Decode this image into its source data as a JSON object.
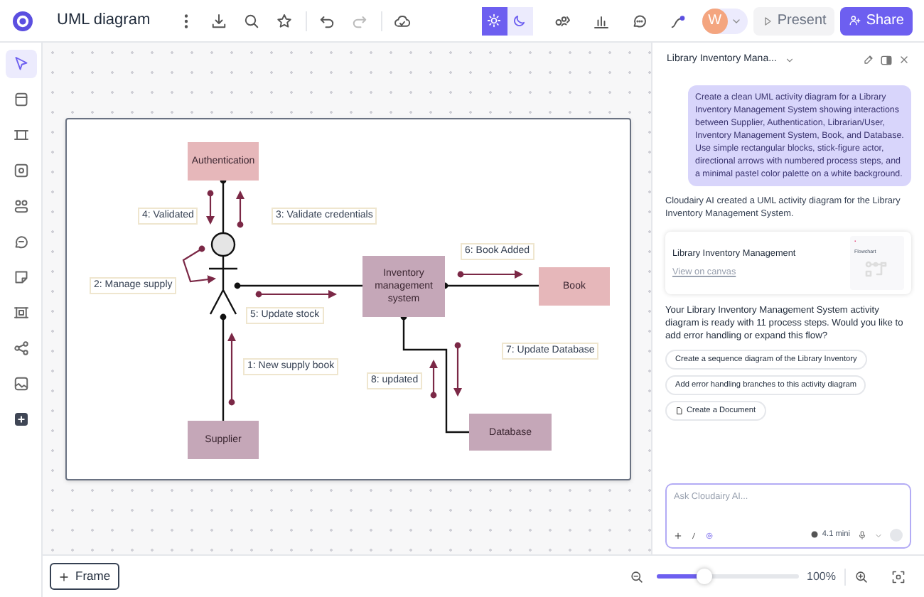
{
  "app": {
    "title": "UML diagram"
  },
  "theme_toggle": [
    {
      "selected": true
    },
    {
      "selected": false
    }
  ],
  "avatar": {
    "initial": "W"
  },
  "buttons": {
    "present": "Present",
    "share": "Share"
  },
  "tools": [
    {
      "selected": true
    },
    {
      "selected": false
    },
    {
      "selected": false
    },
    {
      "selected": false
    },
    {
      "selected": false
    },
    {
      "selected": false
    },
    {
      "selected": false
    },
    {
      "selected": false
    },
    {
      "selected": false
    },
    {
      "selected": false
    },
    {
      "selected": false
    }
  ],
  "diagram": {
    "nodes": [
      {
        "label": "Authentication",
        "color": "#e6b7ba"
      },
      {
        "label": "Inventory management system",
        "color": "#c5a7b8"
      },
      {
        "label": "Book",
        "color": "#e6b7ba"
      },
      {
        "label": "Supplier",
        "color": "#c5a7b8"
      },
      {
        "label": "Database",
        "color": "#c5a7b8"
      }
    ],
    "messages": [
      {
        "label": "4: Validated"
      },
      {
        "label": "3: Validate credentials"
      },
      {
        "label": "6: Book Added"
      },
      {
        "label": "2: Manage supply"
      },
      {
        "label": "5: Update stock"
      },
      {
        "label": "7: Update Database"
      },
      {
        "label": "1: New supply book"
      },
      {
        "label": "8: updated"
      }
    ]
  },
  "chat": {
    "title": "Library Inventory Mana...",
    "prompt": "Create a clean UML activity diagram for a Library Inventory Management System showing interactions between Supplier, Authentication, Librarian/User, Inventory Management System, Book, and Database. Use simple rectangular blocks, stick-figure actor, directional arrows with numbered process steps, and a minimal pastel color palette on a white background.",
    "reply": "Cloudairy AI created a UML activity diagram for the Library Inventory Management System.",
    "card": {
      "title": "Library Inventory Management",
      "link": "View on canvas",
      "thumb_label": "Flowchart"
    },
    "followup": "Your Library Inventory Management System activity diagram is ready with 11 process steps. Would you like to add error handling or expand this flow?",
    "suggestions": [
      {
        "label": "Create a sequence diagram of the Library Inventory",
        "kind": "prompt"
      },
      {
        "label": "Add error handling branches to this activity diagram",
        "kind": "prompt"
      },
      {
        "label": "Create a Document",
        "kind": "document"
      }
    ],
    "input": {
      "placeholder": "Ask Cloudairy AI...",
      "model": "4.1 mini"
    }
  },
  "bottom": {
    "frame_button": "Frame",
    "zoom": {
      "level": 0.33,
      "reading": "100%"
    }
  }
}
